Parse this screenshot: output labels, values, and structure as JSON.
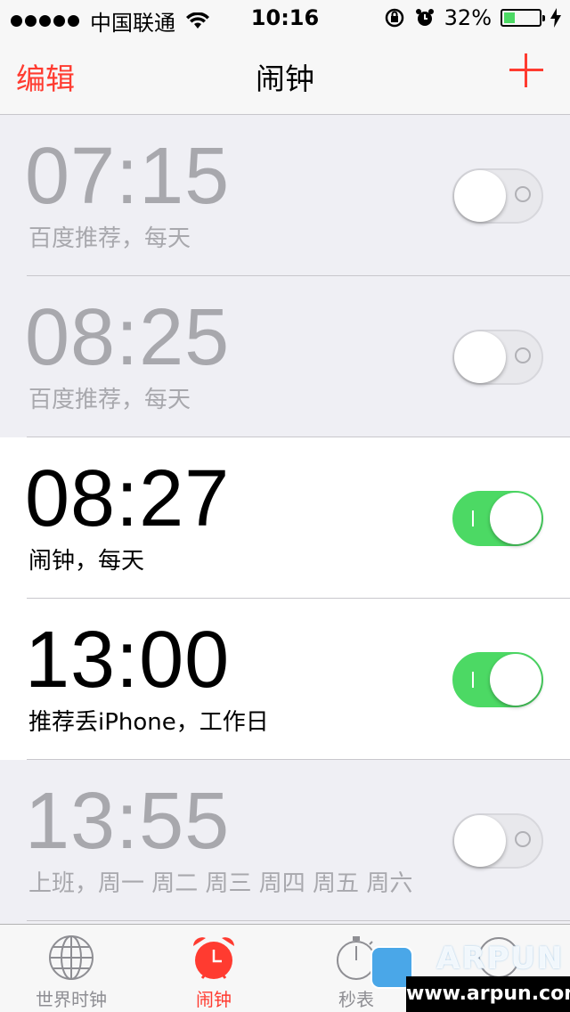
{
  "status_bar": {
    "carrier": "中国联通",
    "time": "10:16",
    "battery": "32%",
    "battery_level": 0.32
  },
  "nav": {
    "edit_label": "编辑",
    "title": "闹钟"
  },
  "alarms": [
    {
      "time": "07:15",
      "label": "百度推荐，每天",
      "enabled": false
    },
    {
      "time": "08:25",
      "label": "百度推荐，每天",
      "enabled": false
    },
    {
      "time": "08:27",
      "label": "闹钟，每天",
      "enabled": true
    },
    {
      "time": "13:00",
      "label": "推荐丢iPhone，工作日",
      "enabled": true
    },
    {
      "time": "13:55",
      "label": "上班，周一 周二 周三 周四 周五 周六",
      "enabled": false
    }
  ],
  "tabs": [
    {
      "label": "世界时钟",
      "icon": "globe-icon",
      "active": false
    },
    {
      "label": "闹钟",
      "icon": "alarm-clock-icon",
      "active": true
    },
    {
      "label": "秒表",
      "icon": "stopwatch-icon",
      "active": false
    },
    {
      "label": "",
      "icon": "timer-icon",
      "active": false
    }
  ],
  "watermark": {
    "brand": "ARPUN",
    "url": "www.arpun.com"
  },
  "colors": {
    "accent": "#ff3b30",
    "toggle_on": "#4cd964",
    "disabled_text": "#a8a8ad"
  }
}
